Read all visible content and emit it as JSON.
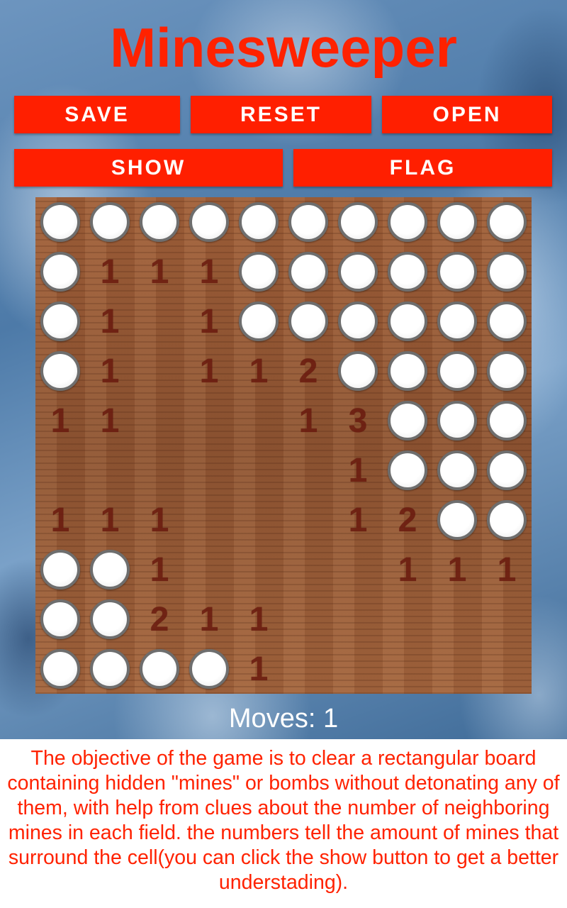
{
  "app": {
    "title": "Minesweeper"
  },
  "buttons": {
    "save": "SAVE",
    "reset": "RESET",
    "open": "OPEN",
    "show": "SHOW",
    "flag": "FLAG"
  },
  "board": {
    "rows": 10,
    "cols": 10,
    "grid": [
      [
        "c",
        "c",
        "c",
        "c",
        "c",
        "c",
        "c",
        "c",
        "c",
        "c"
      ],
      [
        "c",
        "1",
        "1",
        "1",
        "c",
        "c",
        "c",
        "c",
        "c",
        "c"
      ],
      [
        "c",
        "1",
        "",
        "1",
        "c",
        "c",
        "c",
        "c",
        "c",
        "c"
      ],
      [
        "c",
        "1",
        "",
        "1",
        "1",
        "2",
        "c",
        "c",
        "c",
        "c"
      ],
      [
        "1",
        "1",
        "",
        "",
        "",
        "1",
        "3",
        "c",
        "c",
        "c"
      ],
      [
        "",
        "",
        "",
        "",
        "",
        "",
        "1",
        "c",
        "c",
        "c"
      ],
      [
        "1",
        "1",
        "1",
        "",
        "",
        "",
        "1",
        "2",
        "c",
        "c"
      ],
      [
        "c",
        "c",
        "1",
        "",
        "",
        "",
        "",
        "1",
        "1",
        "1"
      ],
      [
        "c",
        "c",
        "2",
        "1",
        "1",
        "",
        "",
        "",
        "",
        ""
      ],
      [
        "c",
        "c",
        "c",
        "c",
        "1",
        "",
        "",
        "",
        "",
        ""
      ]
    ]
  },
  "status": {
    "moves": "Moves: 1"
  },
  "description": "The objective of the game is to clear a rectangular board containing hidden \"mines\" or bombs without detonating any of them, with help from clues about the number of neighboring mines in each field. the numbers tell the amount of mines that surround the cell(you can click the show button to get a better understading)."
}
